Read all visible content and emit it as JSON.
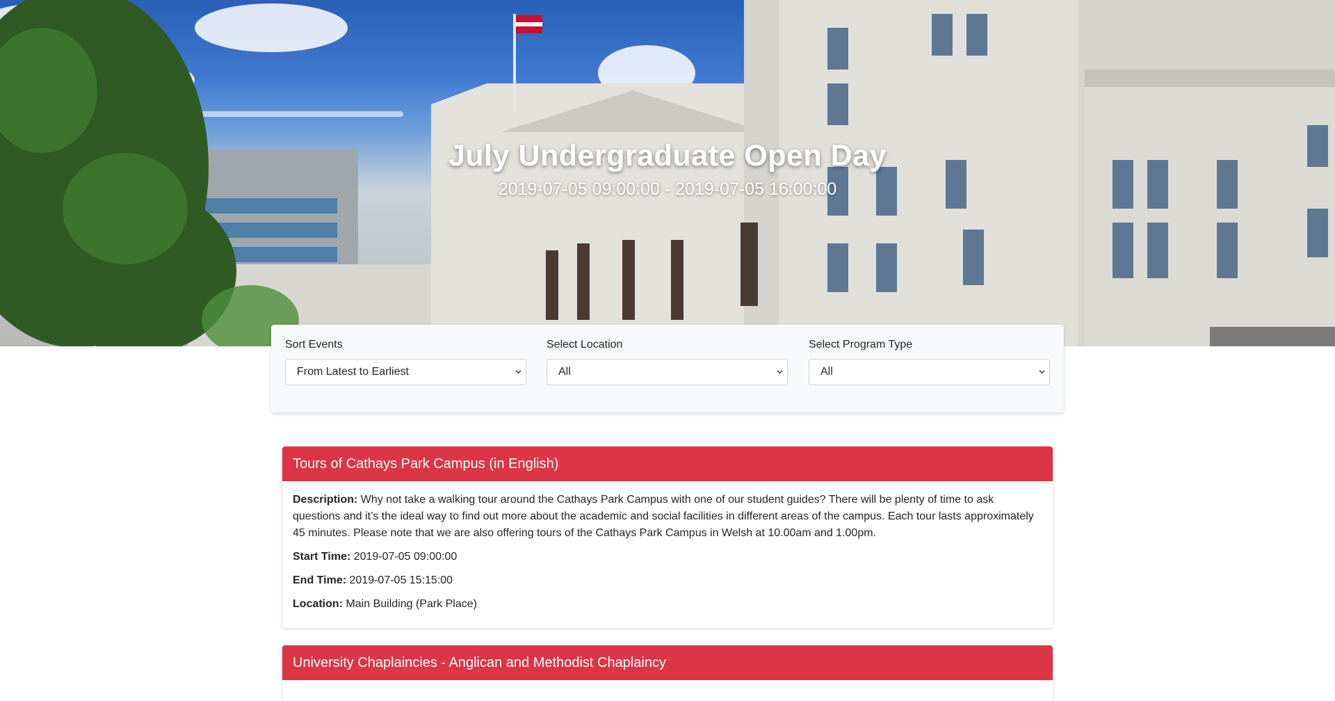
{
  "hero": {
    "title": "July Undergraduate Open Day",
    "dates": "2019-07-05 09:00:00 - 2019-07-05 16:00:00"
  },
  "filters": {
    "sort": {
      "label": "Sort Events",
      "value": "From Latest to Earliest"
    },
    "location": {
      "label": "Select Location",
      "value": "All"
    },
    "program": {
      "label": "Select Program Type",
      "value": "All"
    }
  },
  "labels": {
    "description": "Description:",
    "start": "Start Time:",
    "end": "End Time:",
    "location": "Location:"
  },
  "events": [
    {
      "title": "Tours of Cathays Park Campus (in English)",
      "description": "Why not take a walking tour around the Cathays Park Campus with one of our student guides? There will be plenty of time to ask questions and it’s the ideal way to find out more about the academic and social facilities in different areas of the campus. Each tour lasts approximately 45 minutes. Please note that we are also offering tours of the Cathays Park Campus in Welsh at 10.00am and 1.00pm.",
      "start": "2019-07-05 09:00:00",
      "end": "2019-07-05 15:15:00",
      "location": "Main Building (Park Place)"
    },
    {
      "title": "University Chaplaincies - Anglican and Methodist Chaplaincy"
    }
  ],
  "colors": {
    "accent": "#dc3545",
    "filter_bg": "#f8f9fa"
  },
  "icons": {
    "select_arrow": "chevron-down-icon"
  }
}
